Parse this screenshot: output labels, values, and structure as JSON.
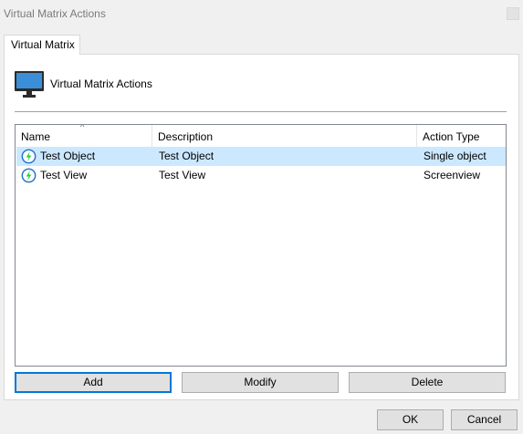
{
  "window": {
    "title": "Virtual Matrix Actions"
  },
  "tabs": [
    {
      "label": "Virtual Matrix"
    }
  ],
  "header": {
    "title": "Virtual Matrix Actions"
  },
  "list": {
    "columns": [
      "Name",
      "Description",
      "Action Type"
    ],
    "rows": [
      {
        "name": "Test Object",
        "description": "Test Object",
        "action_type": "Single object",
        "selected": true
      },
      {
        "name": "Test View",
        "description": "Test View",
        "action_type": "Screenview",
        "selected": false
      }
    ]
  },
  "panel_buttons": {
    "add": "Add",
    "modify": "Modify",
    "delete": "Delete"
  },
  "dialog_buttons": {
    "ok": "OK",
    "cancel": "Cancel"
  },
  "icons": {
    "header": "monitor-icon",
    "row": "lightning-icon",
    "close": "close-icon"
  },
  "colors": {
    "selection": "#cce8ff",
    "accent": "#0078d7",
    "lightning": "#2ecc40"
  }
}
